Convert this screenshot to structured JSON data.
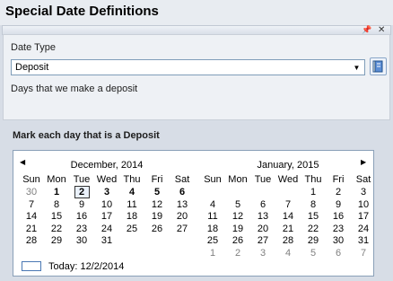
{
  "title": "Special Date Definitions",
  "toolbar": {
    "pin_icon": "pin-icon",
    "close_icon": "close-icon"
  },
  "date_type": {
    "label": "Date Type",
    "value": "Deposit",
    "description": "Days that we make a deposit"
  },
  "mark_label": "Mark each day that is a Deposit",
  "calendar": {
    "dow": [
      "Sun",
      "Mon",
      "Tue",
      "Wed",
      "Thu",
      "Fri",
      "Sat"
    ],
    "months": [
      {
        "title": "December, 2014",
        "weeks": [
          [
            "30",
            "1",
            "2",
            "3",
            "4",
            "5",
            "6"
          ],
          [
            "7",
            "8",
            "9",
            "10",
            "11",
            "12",
            "13"
          ],
          [
            "14",
            "15",
            "16",
            "17",
            "18",
            "19",
            "20"
          ],
          [
            "21",
            "22",
            "23",
            "24",
            "25",
            "26",
            "27"
          ],
          [
            "28",
            "29",
            "30",
            "31",
            "",
            "",
            ""
          ]
        ],
        "other_month": [
          [
            0,
            0
          ]
        ],
        "bold": [
          [
            0,
            1
          ],
          [
            0,
            2
          ],
          [
            0,
            3
          ],
          [
            0,
            4
          ],
          [
            0,
            5
          ],
          [
            0,
            6
          ]
        ],
        "today": [
          0,
          2
        ]
      },
      {
        "title": "January, 2015",
        "weeks": [
          [
            "",
            "",
            "",
            "",
            "1",
            "2",
            "3"
          ],
          [
            "4",
            "5",
            "6",
            "7",
            "8",
            "9",
            "10"
          ],
          [
            "11",
            "12",
            "13",
            "14",
            "15",
            "16",
            "17"
          ],
          [
            "18",
            "19",
            "20",
            "21",
            "22",
            "23",
            "24"
          ],
          [
            "25",
            "26",
            "27",
            "28",
            "29",
            "30",
            "31"
          ],
          [
            "1",
            "2",
            "3",
            "4",
            "5",
            "6",
            "7"
          ]
        ],
        "other_month": [
          [
            5,
            0
          ],
          [
            5,
            1
          ],
          [
            5,
            2
          ],
          [
            5,
            3
          ],
          [
            5,
            4
          ],
          [
            5,
            5
          ],
          [
            5,
            6
          ]
        ],
        "bold": [],
        "today": null
      }
    ],
    "today_label": "Today: 12/2/2014"
  },
  "colors": {
    "accent": "#4a78b3",
    "panel": "#d7dde6"
  }
}
